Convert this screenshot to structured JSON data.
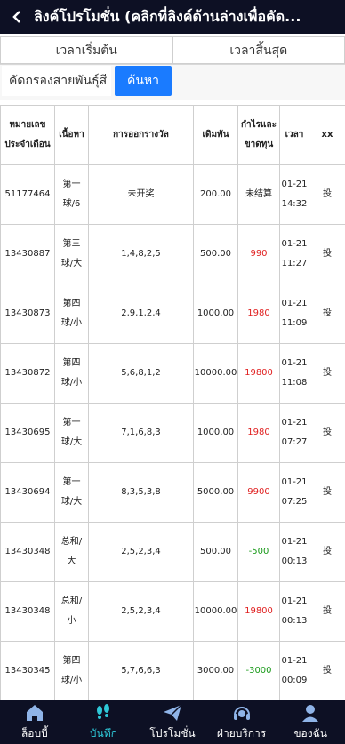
{
  "header": {
    "title": "ลิงค์โปรโมชั่น (คลิกที่ลิงค์ด้านล่างเพื่อคัด..."
  },
  "time": {
    "start": "เวลาเริ่มต้น",
    "end": "เวลาสิ้นสุด"
  },
  "filter": {
    "placeholder": "คัดกรองสายพันธุ์สี",
    "search": "ค้นหา"
  },
  "table": {
    "headers": {
      "issue_l1": "หมายเลข",
      "issue_l2": "ประจำเดือน",
      "content": "เนื้อหา",
      "draw": "การออกรางวัล",
      "bet": "เดิมพัน",
      "pl_l1": "กำไรและ",
      "pl_l2": "ขาดทุน",
      "time": "เวลา",
      "xx": "xx"
    },
    "rows": [
      {
        "issue": "51177464",
        "c1": "第一",
        "c2": "球/6",
        "draw": "未开奖",
        "bet": "200.00",
        "pl": "未结算",
        "d": "01-21",
        "t": "14:32",
        "x": "投",
        "cls": ""
      },
      {
        "issue": "13430887",
        "c1": "第三",
        "c2": "球/大",
        "draw": "1,4,8,2,5",
        "bet": "500.00",
        "pl": "990",
        "d": "01-21",
        "t": "11:27",
        "x": "投",
        "cls": "red"
      },
      {
        "issue": "13430873",
        "c1": "第四",
        "c2": "球/小",
        "draw": "2,9,1,2,4",
        "bet": "1000.00",
        "pl": "1980",
        "d": "01-21",
        "t": "11:09",
        "x": "投",
        "cls": "red"
      },
      {
        "issue": "13430872",
        "c1": "第四",
        "c2": "球/小",
        "draw": "5,6,8,1,2",
        "bet": "10000.00",
        "pl": "19800",
        "d": "01-21",
        "t": "11:08",
        "x": "投",
        "cls": "red"
      },
      {
        "issue": "13430695",
        "c1": "第一",
        "c2": "球/大",
        "draw": "7,1,6,8,3",
        "bet": "1000.00",
        "pl": "1980",
        "d": "01-21",
        "t": "07:27",
        "x": "投",
        "cls": "red"
      },
      {
        "issue": "13430694",
        "c1": "第一",
        "c2": "球/大",
        "draw": "8,3,5,3,8",
        "bet": "5000.00",
        "pl": "9900",
        "d": "01-21",
        "t": "07:25",
        "x": "投",
        "cls": "red"
      },
      {
        "issue": "13430348",
        "c1": "总和/",
        "c2": "大",
        "draw": "2,5,2,3,4",
        "bet": "500.00",
        "pl": "-500",
        "d": "01-21",
        "t": "00:13",
        "x": "投",
        "cls": "green"
      },
      {
        "issue": "13430348",
        "c1": "总和/",
        "c2": "小",
        "draw": "2,5,2,3,4",
        "bet": "10000.00",
        "pl": "19800",
        "d": "01-21",
        "t": "00:13",
        "x": "投",
        "cls": "red"
      },
      {
        "issue": "13430345",
        "c1": "第四",
        "c2": "球/小",
        "draw": "5,7,6,6,3",
        "bet": "3000.00",
        "pl": "-3000",
        "d": "01-21",
        "t": "00:09",
        "x": "投",
        "cls": "green"
      }
    ]
  },
  "tabs": [
    {
      "label": "ล็อบบี้",
      "icon": "home-icon",
      "active": false
    },
    {
      "label": "บันทึก",
      "icon": "footprint-icon",
      "active": true
    },
    {
      "label": "โปรโมชั่น",
      "icon": "paper-plane-icon",
      "active": false
    },
    {
      "label": "ฝ่ายบริการ",
      "icon": "headset-icon",
      "active": false
    },
    {
      "label": "ของฉัน",
      "icon": "user-icon",
      "active": false
    }
  ],
  "colors": {
    "header_bg": "#0d1024",
    "accent": "#1a7bff",
    "profit": "#e02020",
    "loss": "#1a9a1a",
    "active_tab": "#2ec8d8"
  }
}
